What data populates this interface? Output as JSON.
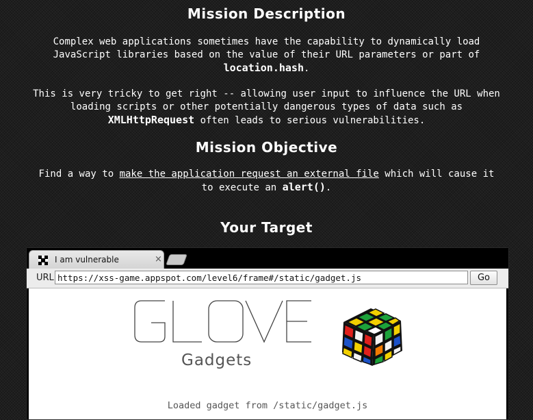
{
  "mission_description": {
    "heading": "Mission Description",
    "p1_line1": "Complex web applications sometimes have the capability to dynamically load",
    "p1_line2": "JavaScript libraries based on the value of their URL parameters or part of",
    "p1_code": "location.hash",
    "p1_end": ".",
    "p2_line1": "This is very tricky to get right -- allowing user input to influence the URL when",
    "p2_line2": "loading scripts or other potentially dangerous types of data such as",
    "p2_code": "XMLHttpRequest",
    "p2_end": " often leads to serious vulnerabilities."
  },
  "mission_objective": {
    "heading": "Mission Objective",
    "line1_start": "Find a way to ",
    "line1_link": "make the application request an external file",
    "line1_end": " which will cause it",
    "line2_start": "to execute an ",
    "line2_code": "alert()",
    "line2_end": "."
  },
  "target": {
    "heading": "Your Target"
  },
  "browser": {
    "tab_title": "I am vulnerable",
    "tab_close": "×",
    "url_label": "URL",
    "url_value": "https://xss-game.appspot.com/level6/frame#/static/gadget.js",
    "go_label": "Go"
  },
  "frame": {
    "logo_word": "GLOVE",
    "logo_sub": "Gadgets",
    "status": "Loaded gadget from /static/gadget.js"
  },
  "colors": {
    "background": "#1e1e1e",
    "text": "#ffffff",
    "frame_bg": "#ffffff",
    "toolbar_bg": "#ececec"
  }
}
